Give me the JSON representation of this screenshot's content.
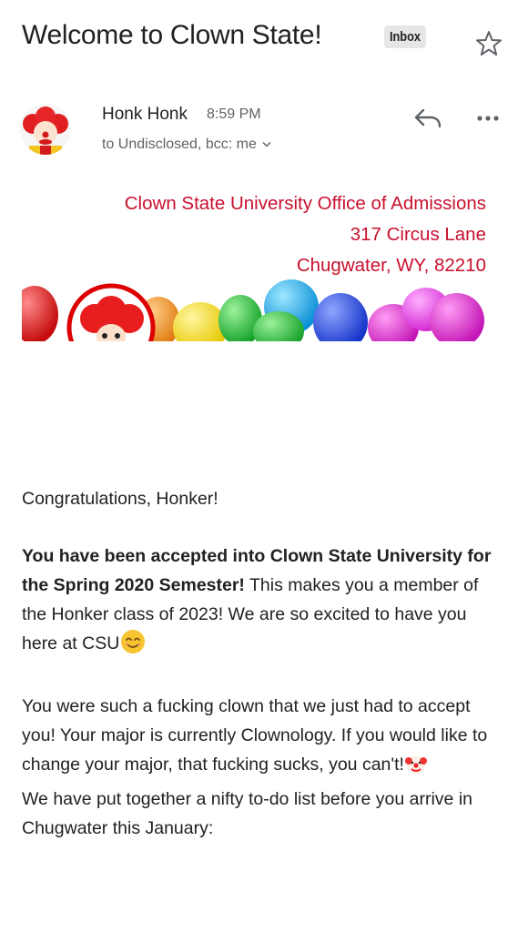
{
  "header": {
    "subject": "Welcome to Clown State!",
    "folder_badge": "Inbox",
    "star_icon": "star-icon"
  },
  "message": {
    "sender_name": "Honk Honk",
    "time": "8:59 PM",
    "recipients": "to Undisclosed, bcc: me",
    "reply_icon": "reply-icon",
    "more_icon": "more-options-icon"
  },
  "letterhead": {
    "line1": "Clown State University Office of Admissions",
    "line2": "317 Circus Lane",
    "line3": "Chugwater, WY, 82210",
    "color": "#c8102e"
  },
  "body": {
    "greeting": "Congratulations, Honker!",
    "acceptance_bold": "You have been accepted into Clown State University for the Spring 2020 Semester!",
    "acceptance_rest": " This makes you a member of the Honker class of 2023! We are so excited to have you here at CSU",
    "major_text": "You were such a fucking clown that we just had to accept you! Your major is currently Clownology. If you would like to change your major, that fucking sucks, you can't!",
    "todo_text": "We have put together a nifty to-do list before you arrive in Chugwater this January:",
    "smile_emoji": "smiling-face-emoji",
    "clown_emoji": "clown-face-emoji"
  }
}
